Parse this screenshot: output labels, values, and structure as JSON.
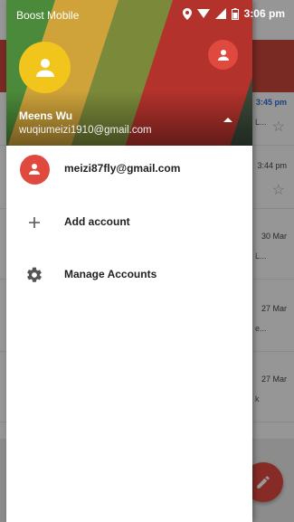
{
  "status_bar": {
    "carrier": "Boost Mobile",
    "time": "3:06 pm"
  },
  "drawer": {
    "account": {
      "name": "Meens Wu",
      "email": "wuqiumeizi1910@gmail.com"
    },
    "items": [
      {
        "label": "meizi87fly@gmail.com",
        "icon": "account-avatar-icon"
      },
      {
        "label": "Add account",
        "icon": "plus-icon"
      },
      {
        "label": "Manage Accounts",
        "icon": "gear-icon"
      }
    ]
  },
  "background": {
    "times": [
      "3:45 pm",
      "3:44 pm",
      "30 Mar",
      "27 Mar",
      "27 Mar"
    ],
    "snippets": [
      "L...",
      "L...",
      "e...",
      "k"
    ]
  },
  "colors": {
    "accent_red": "#e0493e",
    "avatar_yellow": "#f2c51c"
  }
}
